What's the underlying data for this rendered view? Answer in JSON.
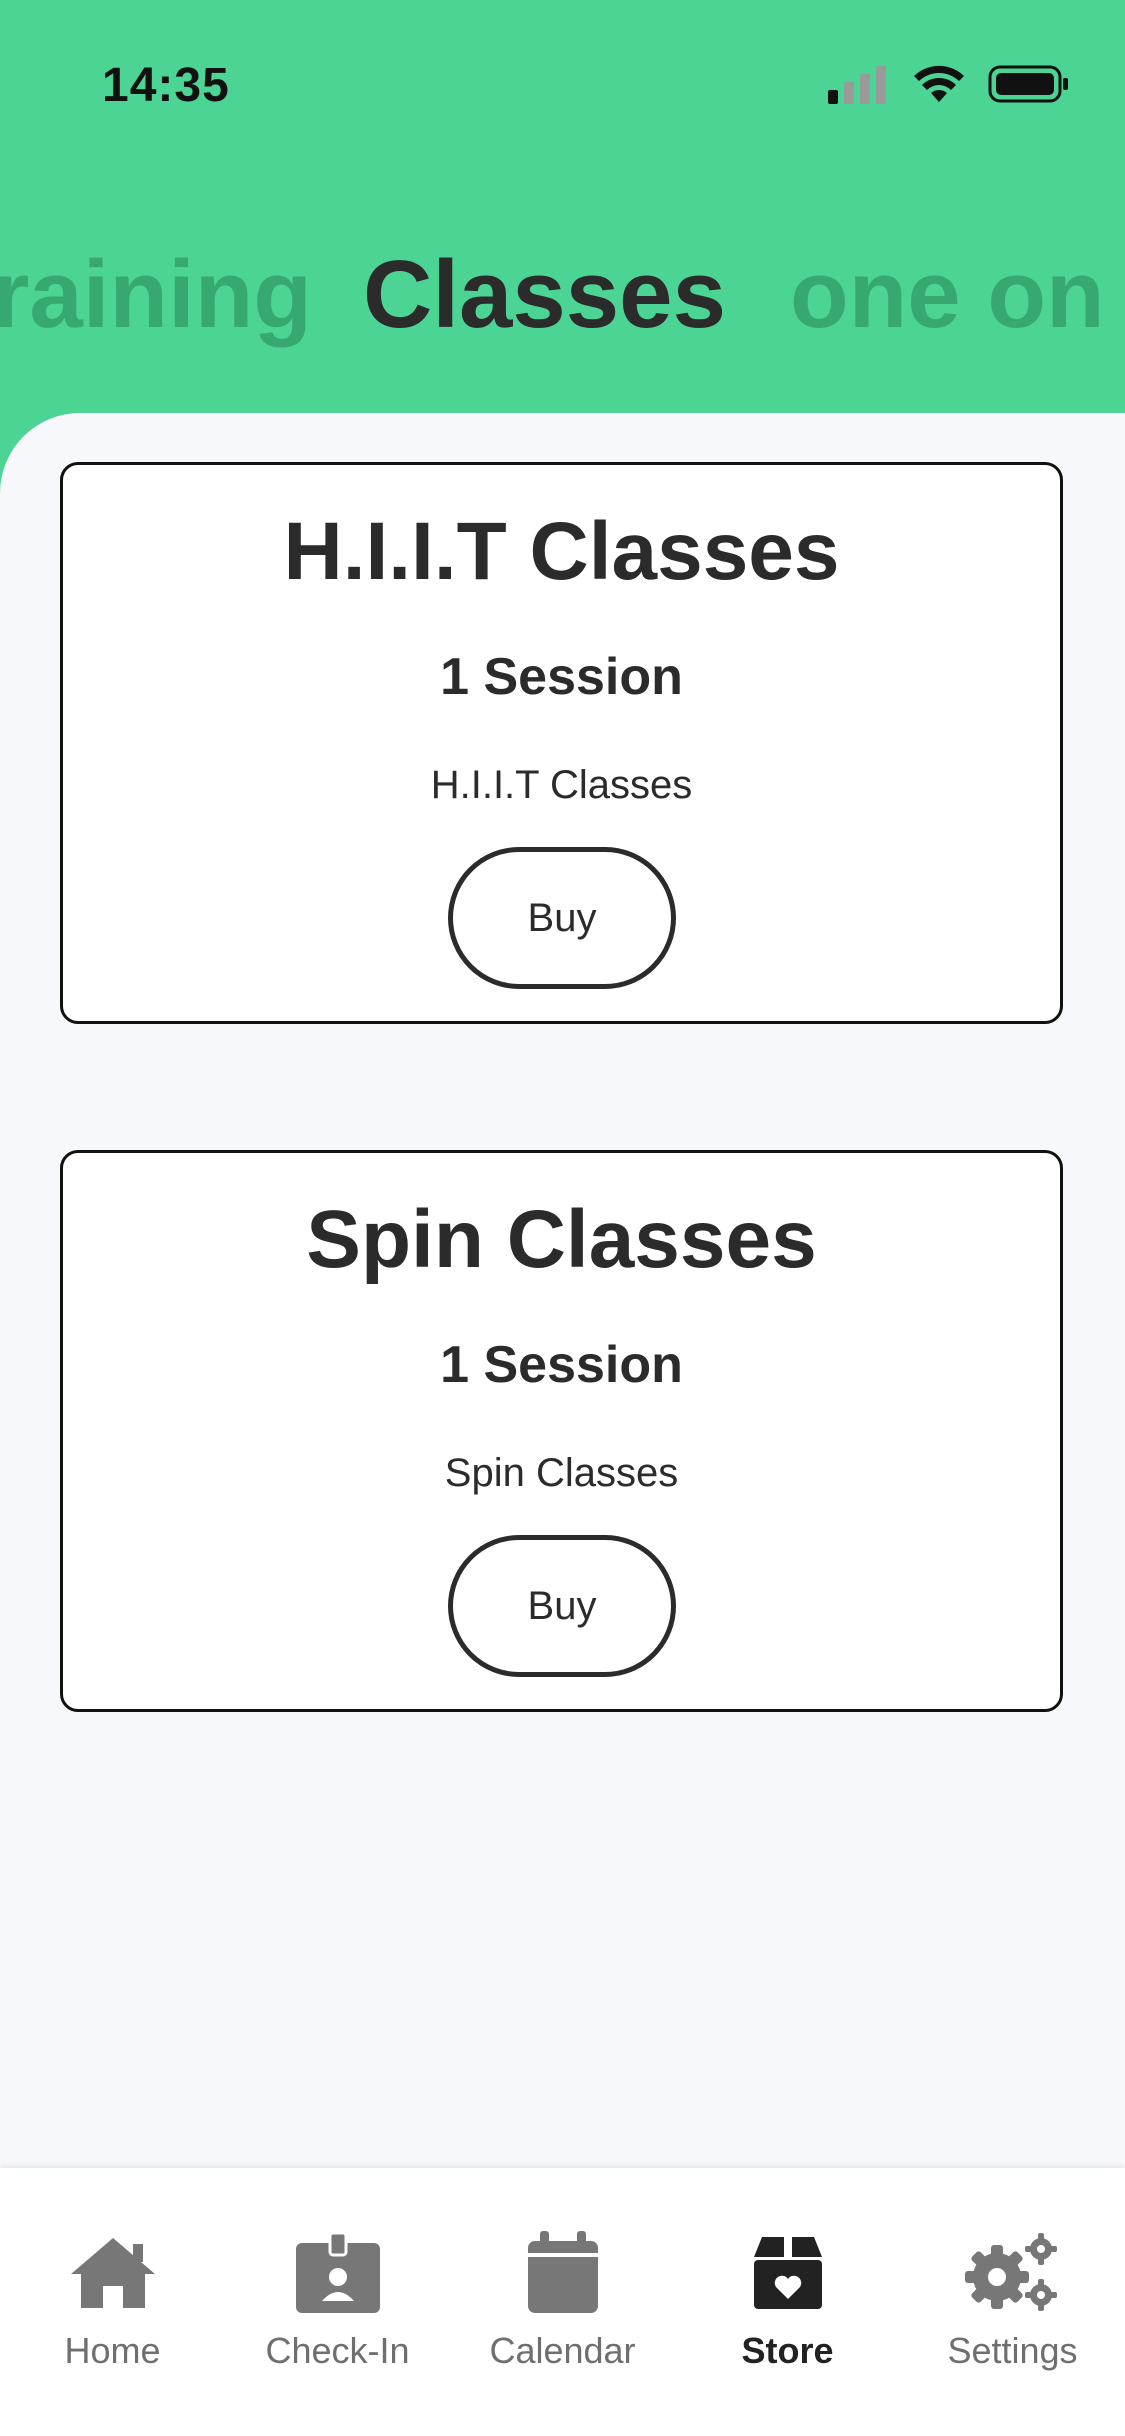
{
  "status": {
    "time": "14:35"
  },
  "tabs": {
    "left": "raining",
    "active": "Classes",
    "right": "one on o"
  },
  "cards": [
    {
      "title": "H.I.I.T Classes",
      "sessions": "1 Session",
      "description": "H.I.I.T Classes",
      "button": "Buy"
    },
    {
      "title": "Spin Classes",
      "sessions": "1 Session",
      "description": "Spin Classes",
      "button": "Buy"
    }
  ],
  "nav": [
    {
      "label": "Home",
      "icon": "home-icon"
    },
    {
      "label": "Check-In",
      "icon": "badge-icon"
    },
    {
      "label": "Calendar",
      "icon": "calendar-icon"
    },
    {
      "label": "Store",
      "icon": "store-icon",
      "active": true
    },
    {
      "label": "Settings",
      "icon": "gears-icon"
    }
  ],
  "colors": {
    "header": "#4bd493",
    "inactive_tab": "#38a872",
    "text": "#2b2b2b",
    "background": "#f7f8fb"
  }
}
